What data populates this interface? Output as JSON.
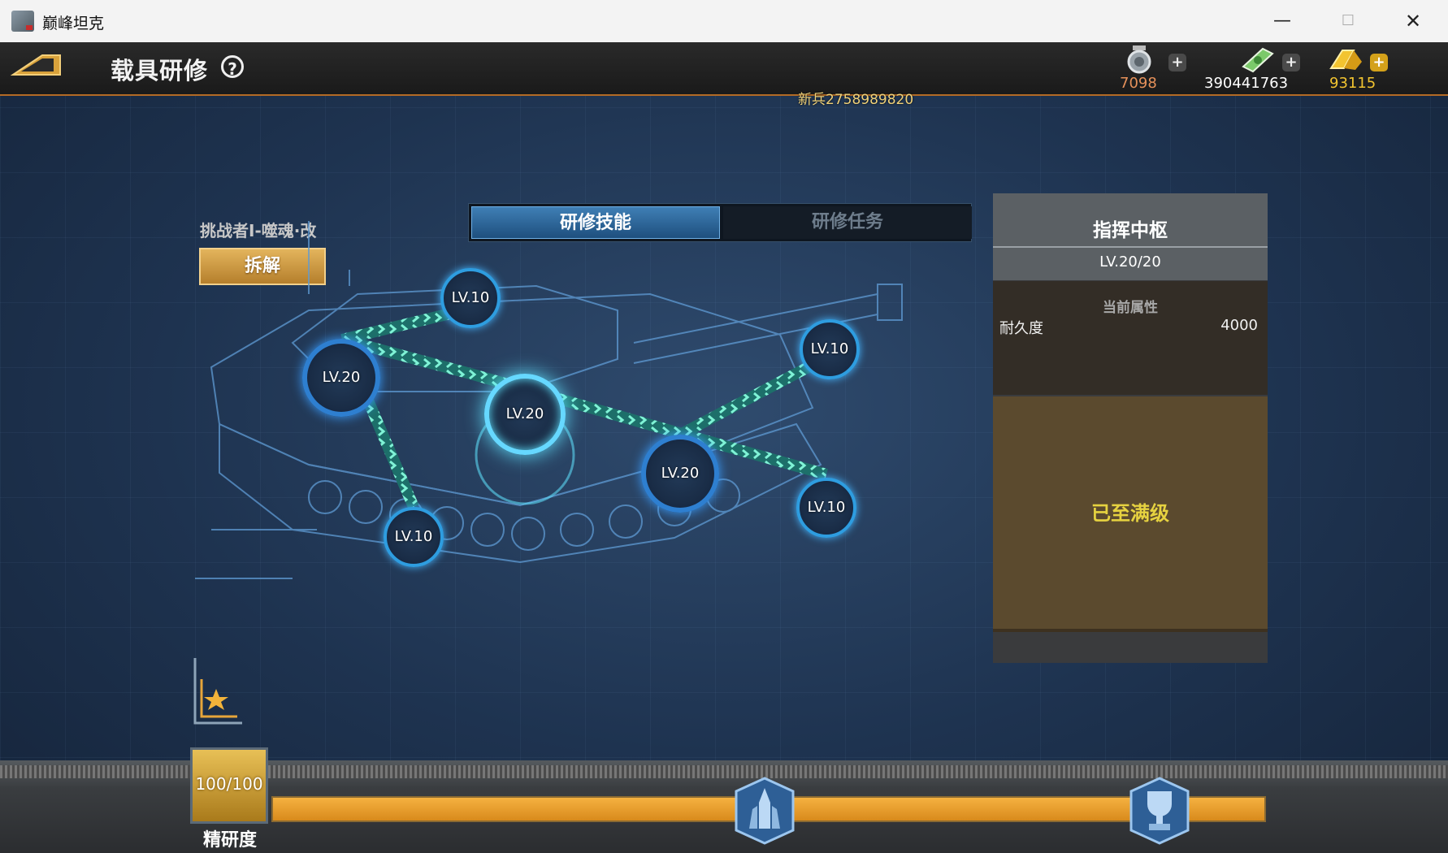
{
  "window": {
    "title": "巅峰坦克"
  },
  "header": {
    "page_title": "载具研修",
    "help_symbol": "?"
  },
  "currencies": [
    {
      "name": "medal",
      "value": "7098",
      "color": "#e6915a",
      "icon": "medal-icon"
    },
    {
      "name": "cash",
      "value": "390441763",
      "color": "#ffffff",
      "icon": "cash-icon"
    },
    {
      "name": "gold",
      "value": "93115",
      "color": "#f2c430",
      "icon": "gold-icon"
    }
  ],
  "player": {
    "name": "新兵2758989820"
  },
  "tank": {
    "name": "挑战者I-噬魂·改",
    "dismantle_label": "拆解"
  },
  "tabs": [
    {
      "label": "研修技能",
      "active": true
    },
    {
      "label": "研修任务",
      "active": false
    }
  ],
  "skill_nodes": [
    {
      "label": "LV.10"
    },
    {
      "label": "LV.20"
    },
    {
      "label": "LV.20",
      "selected": true
    },
    {
      "label": "LV.10"
    },
    {
      "label": "LV.20"
    },
    {
      "label": "LV.10"
    },
    {
      "label": "LV.10"
    }
  ],
  "panel": {
    "title": "指挥中枢",
    "level": "LV.20/20",
    "attr_heading": "当前属性",
    "attr_name": "耐久度",
    "attr_value": "4000",
    "status": "已至满级"
  },
  "precision": {
    "value": "100/100",
    "label": "精研度",
    "progress": 1.0
  },
  "colors": {
    "accent": "#2e9de0",
    "progress": "#e89a2a",
    "panel_max": "#5b4a2e"
  }
}
